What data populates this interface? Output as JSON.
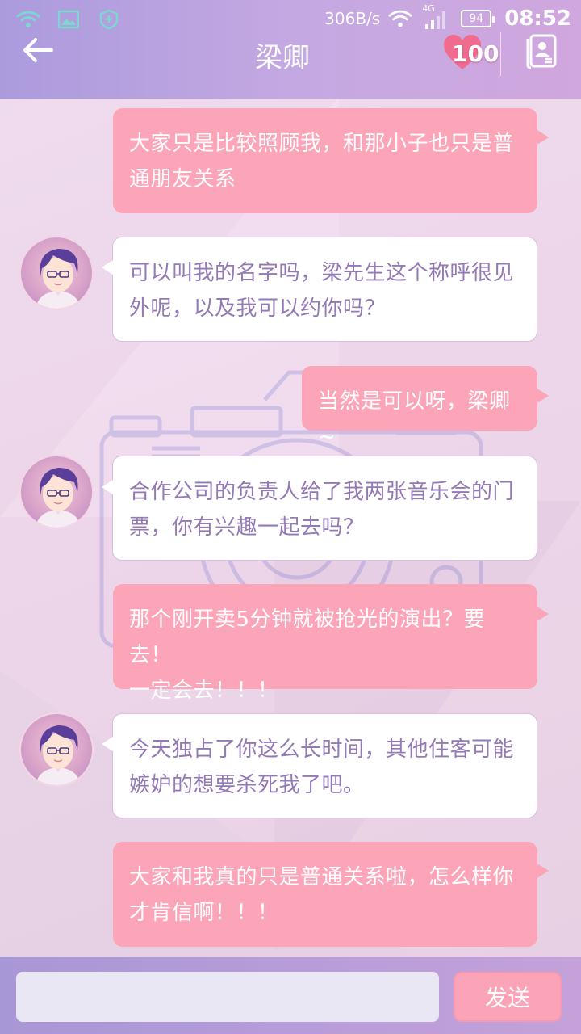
{
  "status_bar": {
    "net_speed": "306B/s",
    "network_type": "4G",
    "battery": "94",
    "time": "08:52",
    "icons": [
      "wifi-icon",
      "image-icon",
      "shield-icon"
    ]
  },
  "header": {
    "title": "梁卿",
    "affection_count": "100",
    "back_icon": "arrow-left-icon",
    "heart_icon": "heart-icon",
    "contact_icon": "contact-card-icon"
  },
  "messages": [
    {
      "sender": "me",
      "lines": [
        "大家只是比较照顾我，和那小子也只是普",
        "通朋友关系"
      ]
    },
    {
      "sender": "other",
      "lines": [
        "可以叫我的名字吗，梁先生这个称呼很见",
        "外呢，以及我可以约你吗？"
      ]
    },
    {
      "sender": "me",
      "lines": [
        "当然是可以呀，梁卿~"
      ]
    },
    {
      "sender": "other",
      "lines": [
        "合作公司的负责人给了我两张音乐会的门",
        "票，你有兴趣一起去吗？"
      ]
    },
    {
      "sender": "me",
      "lines": [
        "那个刚开卖5分钟就被抢光的演出？要去！",
        "一定会去！！！"
      ]
    },
    {
      "sender": "other",
      "lines": [
        "今天独占了你这么长时间，其他住客可能",
        "嫉妒的想要杀死我了吧。"
      ]
    },
    {
      "sender": "me",
      "lines": [
        "大家和我真的只是普通关系啦，怎么样你",
        "才肯信啊！！！"
      ]
    }
  ],
  "composer": {
    "input_value": "",
    "input_placeholder": "",
    "send_label": "发送"
  },
  "colors": {
    "my_bubble": "#fca4b8",
    "other_text": "#9379b5",
    "header_accent": "#b9a3de"
  }
}
